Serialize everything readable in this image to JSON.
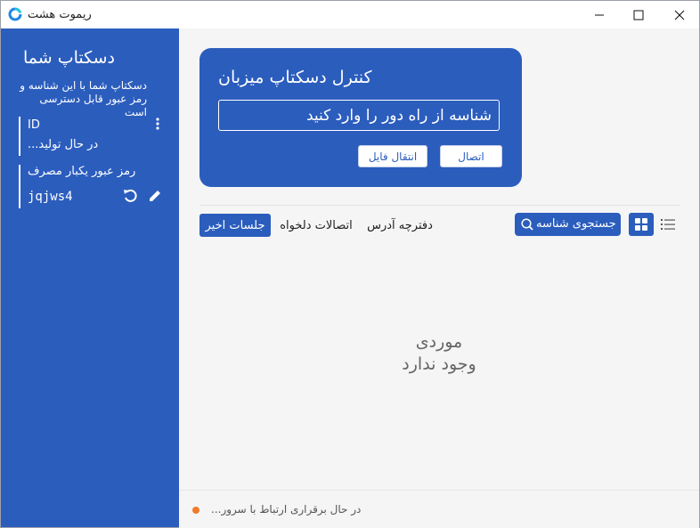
{
  "window": {
    "title": "ریموت هشت"
  },
  "sidebar": {
    "title": "دسکتاپ شما",
    "description": "دسکتاپ شما با این شناسه و رمز عبور قابل دسترسی است",
    "id_label": "ID",
    "id_value": "در حال تولید...",
    "password_label": "رمز عبور یکبار مصرف",
    "password_value": "jqjws4"
  },
  "control": {
    "title": "کنترل دسکتاپ میزبان",
    "input_placeholder": "شناسه از راه دور را وارد کنید",
    "connect_label": "اتصال",
    "transfer_label": "انتقال فایل"
  },
  "tabs": [
    {
      "label": "جلسات اخیر",
      "active": true
    },
    {
      "label": "اتصالات دلخواه",
      "active": false
    },
    {
      "label": "دفترچه آدرس",
      "active": false
    }
  ],
  "search": {
    "label": "جستجوی شناسه"
  },
  "empty": {
    "line1": "موردی",
    "line2": "وجود ندارد"
  },
  "status": {
    "text": "در حال برقراری ارتباط با سرور...",
    "dot_color": "#f27b2c"
  },
  "colors": {
    "accent": "#2b5dbd",
    "background": "#f5f5f5"
  }
}
